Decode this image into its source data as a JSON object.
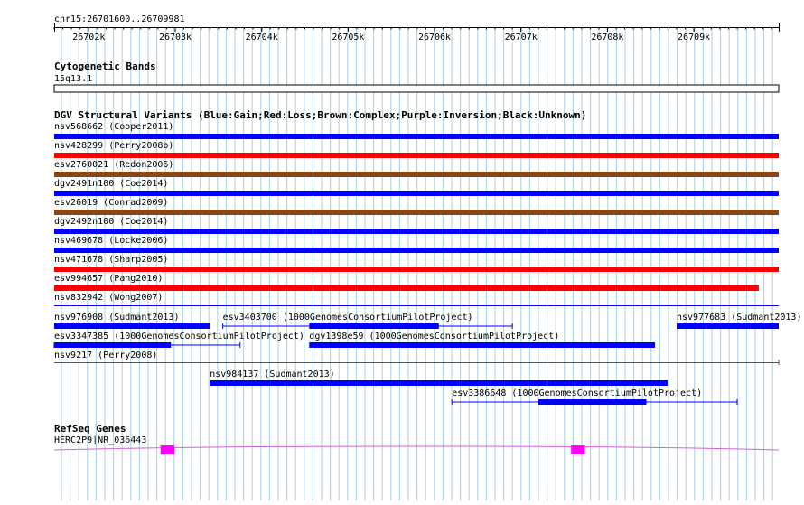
{
  "location": "chr15:26701600..26709981",
  "ruler": {
    "ticks": [
      {
        "label": "26702k",
        "pos": 26702000
      },
      {
        "label": "26703k",
        "pos": 26703000
      },
      {
        "label": "26704k",
        "pos": 26704000
      },
      {
        "label": "26705k",
        "pos": 26705000
      },
      {
        "label": "26706k",
        "pos": 26706000
      },
      {
        "label": "26707k",
        "pos": 26707000
      },
      {
        "label": "26708k",
        "pos": 26708000
      },
      {
        "label": "26709k",
        "pos": 26709000
      }
    ]
  },
  "colors": {
    "grid": "#a9d1e1",
    "gain": "#0000ff",
    "loss": "#ff0000",
    "complex": "#8b4513",
    "unknown": "#000000",
    "gene": "#ff00ff",
    "intron": "#d066d0"
  },
  "cyto": {
    "title": "Cytogenetic Bands",
    "band": "15q13.1"
  },
  "dgv": {
    "title": "DGV Structural Variants (Blue:Gain;Red:Loss;Brown:Complex;Purple:Inversion;Black:Unknown)",
    "fullRows": [
      {
        "label": "nsv568662 (Cooper2011)",
        "color": "gain",
        "end": 26709981
      },
      {
        "label": "nsv428299 (Perry2008b)",
        "color": "loss",
        "end": 26709981
      },
      {
        "label": "esv2760021 (Redon2006)",
        "color": "complex",
        "end": 26709981
      },
      {
        "label": "dgv2491n100 (Coe2014)",
        "color": "gain",
        "end": 26709981
      },
      {
        "label": "esv26019 (Conrad2009)",
        "color": "complex",
        "end": 26709981
      },
      {
        "label": "dgv2492n100 (Coe2014)",
        "color": "gain",
        "end": 26709981
      },
      {
        "label": "nsv469678 (Locke2006)",
        "color": "gain",
        "end": 26709981
      },
      {
        "label": "nsv471678 (Sharp2005)",
        "color": "loss",
        "end": 26709981
      },
      {
        "label": "esv994657 (Pang2010)",
        "color": "loss",
        "end": 26709750
      },
      {
        "label": "nsv832942 (Wong2007)",
        "color": "none",
        "end": 26709981
      }
    ],
    "features": [
      {
        "label": "nsv976908 (Sudmant2013)",
        "color": "gain",
        "start": 26701600,
        "end": 26703400,
        "row": 0
      },
      {
        "label": "esv3403700 (1000GenomesConsortiumPilotProject)",
        "color": "gain",
        "start": 26703550,
        "end": 26706900,
        "thickStart": 26704550,
        "thickEnd": 26706050,
        "row": 0
      },
      {
        "label": "nsv977683 (Sudmant2013)",
        "color": "gain",
        "start": 26708800,
        "end": 26709981,
        "row": 0
      },
      {
        "label": "esv3347385 (1000GenomesConsortiumPilotProject)",
        "color": "gain",
        "start": 26701600,
        "end": 26703750,
        "thickEnd": 26702950,
        "row": 1
      },
      {
        "label": "dgv1398e59 (1000GenomesConsortiumPilotProject)",
        "color": "gain",
        "start": 26704550,
        "end": 26708550,
        "row": 1
      },
      {
        "label": "nsv9217 (Perry2008)",
        "color": "complex",
        "start": 26701600,
        "end": 26709981,
        "thin": true,
        "row": 2
      },
      {
        "label": "nsv984137 (Sudmant2013)",
        "color": "gain",
        "start": 26703400,
        "end": 26708700,
        "row": 3
      },
      {
        "label": "esv3386648 (1000GenomesConsortiumPilotProject)",
        "color": "gain",
        "start": 26706200,
        "end": 26709500,
        "thickStart": 26707200,
        "thickEnd": 26708450,
        "row": 4
      }
    ]
  },
  "genes": {
    "title": "RefSeq Genes",
    "items": [
      {
        "label": "HERC2P9|NR_036443",
        "start": 26701600,
        "end": 26709981,
        "exons": [
          {
            "start": 26702830,
            "end": 26702990
          },
          {
            "start": 26707580,
            "end": 26707740
          }
        ]
      }
    ]
  }
}
